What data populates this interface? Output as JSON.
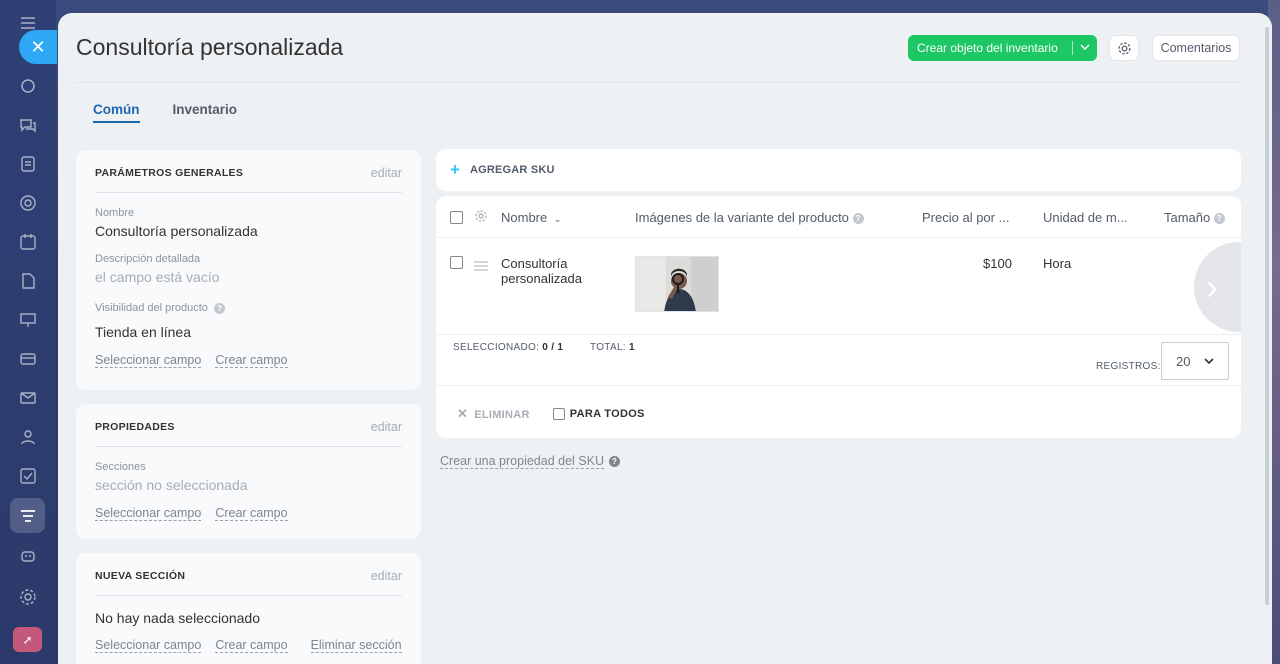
{
  "page": {
    "title": "Consultoría personalizada"
  },
  "header": {
    "create_button": "Crear objeto del inventario",
    "comments_button": "Comentarios"
  },
  "tabs": [
    {
      "label": "Común",
      "active": true
    },
    {
      "label": "Inventario",
      "active": false
    }
  ],
  "general_params": {
    "title": "PARÁMETROS GENERALES",
    "edit": "editar",
    "name_label": "Nombre",
    "name_value": "Consultoría personalizada",
    "description_label": "Descripción detallada",
    "description_value": "el campo está vacío",
    "visibility_label": "Visibilidad del producto",
    "visibility_value": "Tienda en línea",
    "select_field": "Seleccionar campo",
    "create_field": "Crear campo"
  },
  "properties": {
    "title": "PROPIEDADES",
    "edit": "editar",
    "sections_label": "Secciones",
    "sections_value": "sección no seleccionada",
    "select_field": "Seleccionar campo",
    "create_field": "Crear campo"
  },
  "new_section": {
    "title": "NUEVA SECCIÓN",
    "edit": "editar",
    "value": "No hay nada seleccionado",
    "select_field": "Seleccionar campo",
    "create_field": "Crear campo",
    "delete_section": "Eliminar sección"
  },
  "sku": {
    "add_label": "AGREGAR SKU",
    "columns": {
      "name": "Nombre",
      "images": "Imágenes de la variante del producto",
      "price": "Precio al por ...",
      "unit": "Unidad de m...",
      "size": "Tamaño"
    },
    "row": {
      "name_line1": "Consultoría",
      "name_line2": "personalizada",
      "price": "$100",
      "unit": "Hora"
    },
    "selected_label": "SELECCIONADO:",
    "selected_value": "0 / 1",
    "total_label": "TOTAL:",
    "total_value": "1",
    "records_label": "REGISTROS:",
    "records_value": "20",
    "delete_label": "ELIMINAR",
    "for_all_label": "PARA TODOS",
    "create_property": "Crear una propiedad del SKU"
  },
  "colors": {
    "accent": "#2067b0",
    "create_button": "#1dc764",
    "close_button": "#2fa8f5"
  }
}
